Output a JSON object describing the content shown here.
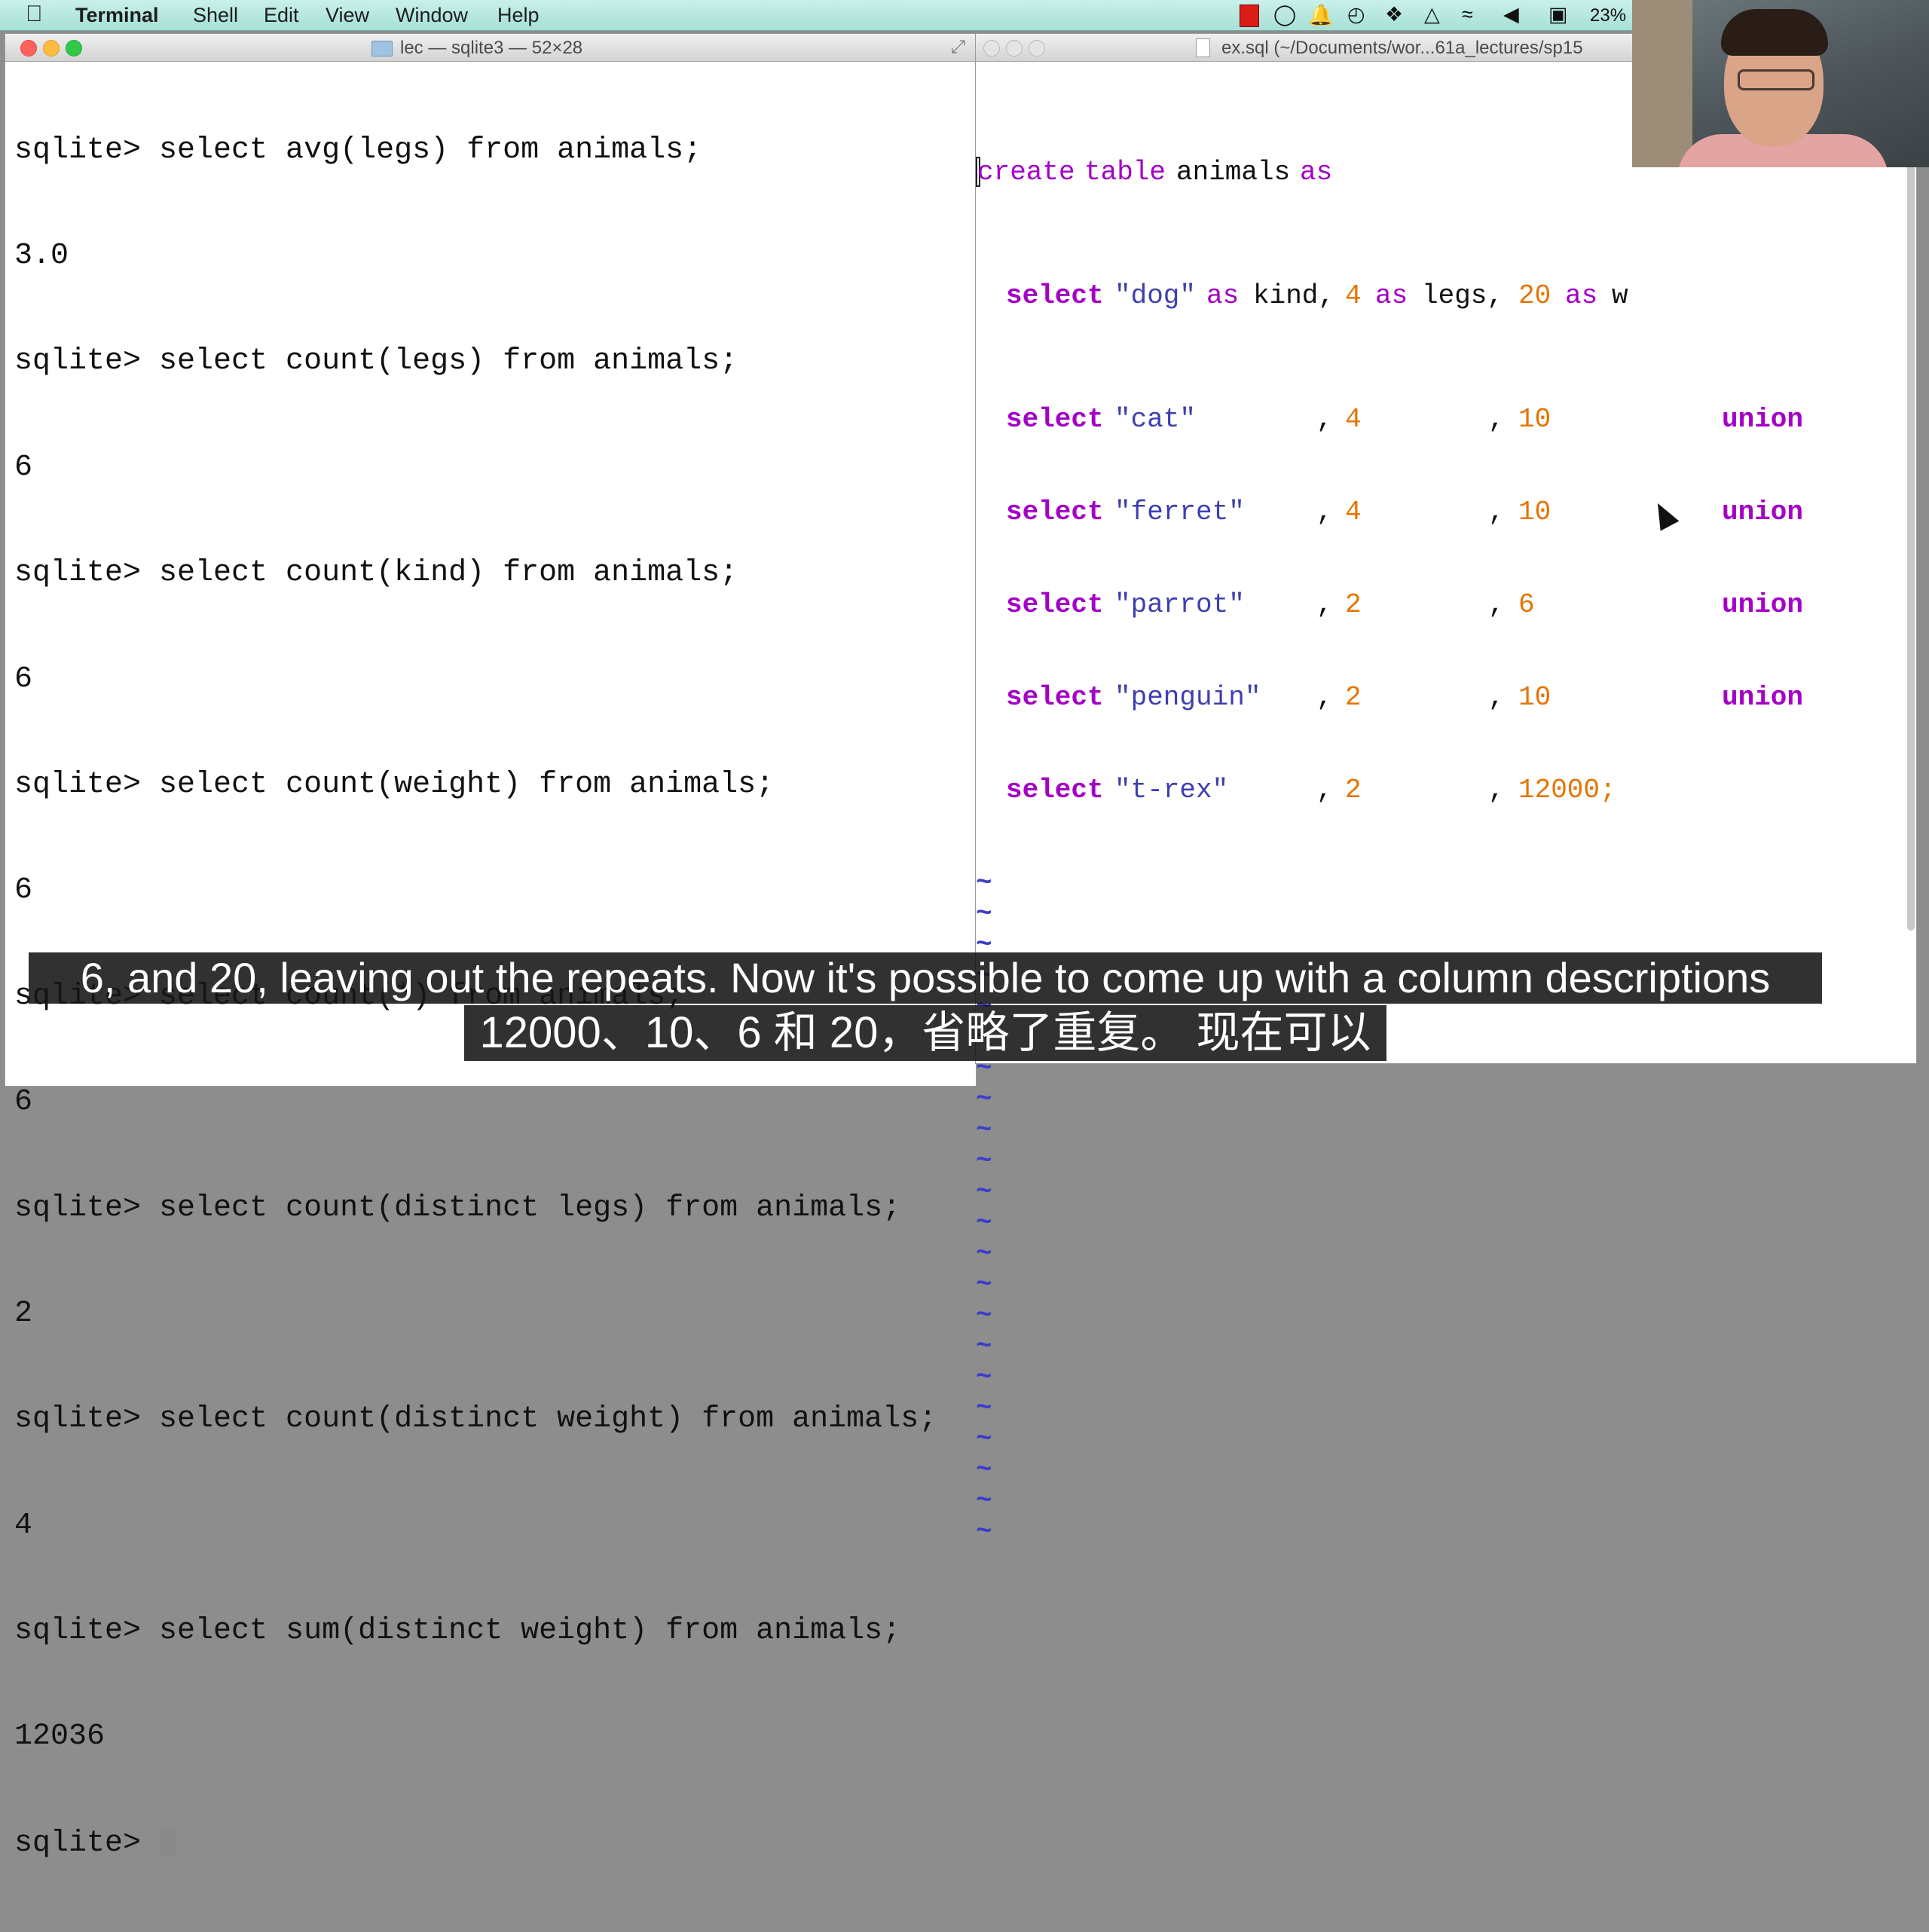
{
  "menubar": {
    "app_name": "Terminal",
    "items": [
      "Shell",
      "Edit",
      "View",
      "Window",
      "Help"
    ],
    "battery_percent": "23%"
  },
  "terminal_window": {
    "title": "lec — sqlite3 — 52×28",
    "lines": [
      "sqlite> select avg(legs) from animals;",
      "3.0",
      "sqlite> select count(legs) from animals;",
      "6",
      "sqlite> select count(kind) from animals;",
      "6",
      "sqlite> select count(weight) from animals;",
      "6",
      "sqlite> select count(*) from animals;",
      "6",
      "sqlite> select count(distinct legs) from animals;",
      "2",
      "sqlite> select count(distinct weight) from animals;",
      "4",
      "sqlite> select sum(distinct weight) from animals;",
      "12036"
    ],
    "prompt": "sqlite> "
  },
  "vim_window": {
    "title": "ex.sql (~/Documents/wor...61a_lectures/sp15",
    "line1": {
      "kw_create": "create",
      "kw_table": "table",
      "name": "animals",
      "kw_as": "as"
    },
    "line2": {
      "select": "select",
      "kind": "\"dog\"",
      "as1": "as",
      "kind_label": "kind,",
      "legs": "4",
      "as2": "as",
      "legs_label": "legs,",
      "weight": "20",
      "as3": "as",
      "weight_label_partial": "w"
    },
    "rows": [
      {
        "select": "select",
        "kind": "\"cat\"",
        "legs": "4",
        "weight": "10",
        "union": "union"
      },
      {
        "select": "select",
        "kind": "\"ferret\"",
        "legs": "4",
        "weight": "10",
        "union": "union"
      },
      {
        "select": "select",
        "kind": "\"parrot\"",
        "legs": "2",
        "weight": "6",
        "union": "union"
      },
      {
        "select": "select",
        "kind": "\"penguin\"",
        "legs": "2",
        "weight": "10",
        "union": "union"
      },
      {
        "select": "select",
        "kind": "\"t-rex\"",
        "legs": "2",
        "weight": "12000;",
        "union": ""
      }
    ],
    "comma": ",",
    "tilde": "~"
  },
  "captions": {
    "english": "6, and 20, leaving out the repeats. Now it's possible to come up with a column descriptions",
    "chinese": "12000、10、6 和 20，省略了重复。 现在可以"
  }
}
